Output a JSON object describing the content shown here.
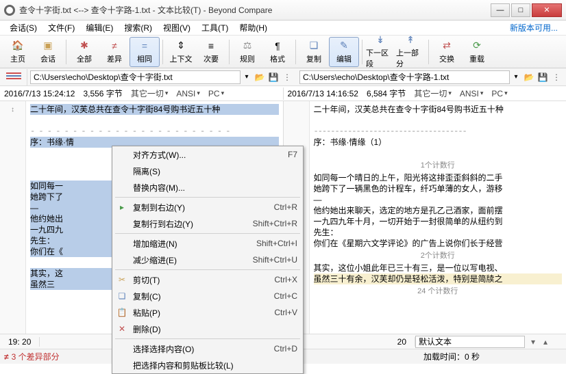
{
  "window": {
    "title": "查令十字街.txt <--> 查令十字路-1.txt - 文本比较(T) - Beyond Compare",
    "minimize": "—",
    "maximize": "□",
    "close": "✕"
  },
  "menu": {
    "session": "会话(S)",
    "file": "文件(F)",
    "edit": "编辑(E)",
    "search": "搜索(R)",
    "view": "视图(V)",
    "tools": "工具(T)",
    "help": "帮助(H)",
    "update": "新版本可用..."
  },
  "toolbar": {
    "home": "主页",
    "session": "会话",
    "all": "全部",
    "diff": "差异",
    "same": "相同",
    "context": "上下文",
    "minor": "次要",
    "rules": "规则",
    "format": "格式",
    "copy": "复制",
    "edit": "编辑",
    "next_section": "下一区段",
    "prev_section": "上一部分",
    "swap": "交换",
    "reload": "重载"
  },
  "paths": {
    "left": "C:\\Users\\echo\\Desktop\\查令十字街.txt",
    "right": "C:\\Users\\echo\\Desktop\\查令十字路-1.txt"
  },
  "stats": {
    "left_date": "2016/7/13 15:24:12",
    "left_size": "3,556 字节",
    "right_date": "2016/7/13 14:16:52",
    "right_size": "6,584 字节",
    "misc": "其它一切",
    "ansi": "ANSI",
    "pc": "PC"
  },
  "left_lines": {
    "l1": "        二十年间，汉芙总共在查令十字街84号购书近五十种",
    "l2": "序：书缘·情",
    "l3": "如同每一",
    "l4": "她跨下了",
    "l5": "—",
    "l6": "他约她出",
    "l7": "一九四九",
    "l8": "先生：",
    "l9": "你们在《",
    "l10": "其实，这",
    "l11": "虽然三"
  },
  "right_lines": {
    "l1": "   二十年间，汉芙总共在查令十字街84号购书近五十种",
    "sep": "------------------------------------",
    "l2": "序：书缘·情缘（1）",
    "sec1": "1个计数行",
    "l3": "如同每一个晴日的上午，阳光将这排歪歪斜斜的二手",
    "l4": "她跨下了一辆黑色的计程车，纤巧单薄的女人，游移",
    "l5": "—",
    "l6": "他约她出来聊天，选定的地方是孔乙己酒家，面前摆",
    "l7": "一九四九年十月，一切开始于一封很简单的从纽约到",
    "l8": "先生：",
    "l9": "你们在《星期六文学评论》的广告上说你们长于经营",
    "sec2": "2个计数行",
    "l10": "其实，这位小姐此年已三十有三，是一位以写电视、",
    "l11": "   虽然三十有余，汉芙却仍是轻松活泼，特别是简牍之",
    "sec3": "24 个计数行"
  },
  "context_menu": {
    "align": "对齐方式(W)...",
    "align_key": "F7",
    "isolate": "隔离(S)",
    "replace": "替换内容(M)...",
    "copy_right": "复制到右边(Y)",
    "copy_right_key": "Ctrl+R",
    "copy_line_right": "复制行到右边(Y)",
    "copy_line_right_key": "Shift+Ctrl+R",
    "add_indent": "增加缩进(N)",
    "add_indent_key": "Shift+Ctrl+I",
    "dec_indent": "减少缩进(E)",
    "dec_indent_key": "Shift+Ctrl+U",
    "cut": "剪切(T)",
    "cut_key": "Ctrl+X",
    "copy": "复制(C)",
    "copy_key": "Ctrl+C",
    "paste": "粘贴(P)",
    "paste_key": "Ctrl+V",
    "delete": "删除(D)",
    "select": "选择选择内容(O)",
    "select_key": "Ctrl+D",
    "compare_clip": "把选择内容和剪贴板比较(L)"
  },
  "footer": {
    "left_pos": "19: 20",
    "right_pos": "20",
    "default_text": "默认文本"
  },
  "status": {
    "diff_count": "3 个差异部分",
    "load_time": "加载时间：0 秒"
  }
}
